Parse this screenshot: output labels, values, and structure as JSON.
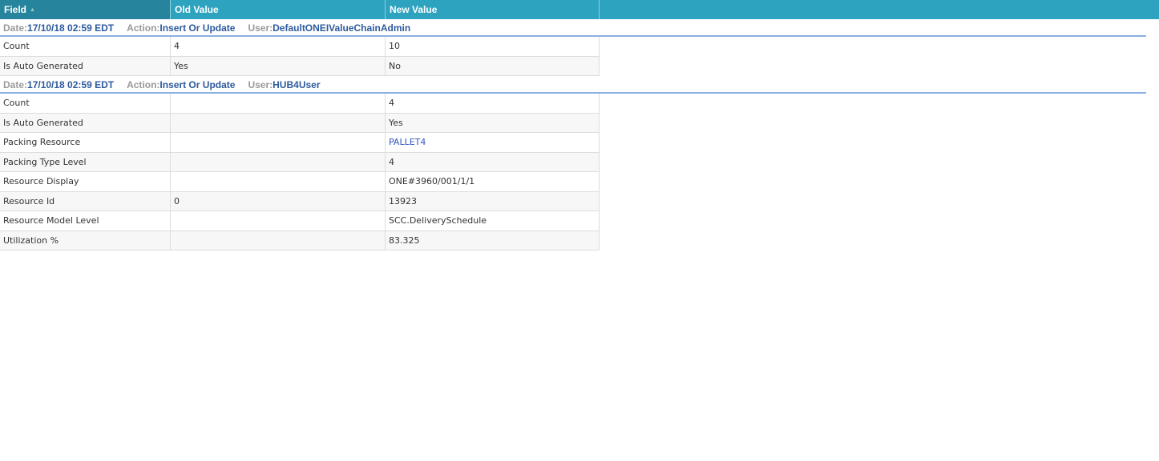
{
  "columns": {
    "field": "Field",
    "old": "Old Value",
    "new": "New Value"
  },
  "labels": {
    "date": "Date:",
    "action": "Action:",
    "user": "User:"
  },
  "groups": [
    {
      "date": "17/10/18 02:59 EDT",
      "action": "Insert Or Update",
      "user": "DefaultONEIValueChainAdmin",
      "rows": [
        {
          "field": "Count",
          "old": "4",
          "new": "10"
        },
        {
          "field": "Is Auto Generated",
          "old": "Yes",
          "new": "No"
        }
      ]
    },
    {
      "date": "17/10/18 02:59 EDT",
      "action": "Insert Or Update",
      "user": "HUB4User",
      "rows": [
        {
          "field": "Count",
          "old": "",
          "new": "4"
        },
        {
          "field": "Is Auto Generated",
          "old": "",
          "new": "Yes"
        },
        {
          "field": "Packing Resource",
          "old": "",
          "new": "PALLET4",
          "link": true
        },
        {
          "field": "Packing Type Level",
          "old": "",
          "new": "4"
        },
        {
          "field": "Resource Display",
          "old": "",
          "new": "ONE#3960/001/1/1"
        },
        {
          "field": "Resource Id",
          "old": "0",
          "new": "13923"
        },
        {
          "field": "Resource Model Level",
          "old": "",
          "new": "SCC.DeliverySchedule"
        },
        {
          "field": "Utilization %",
          "old": "",
          "new": "83.325"
        }
      ]
    }
  ]
}
